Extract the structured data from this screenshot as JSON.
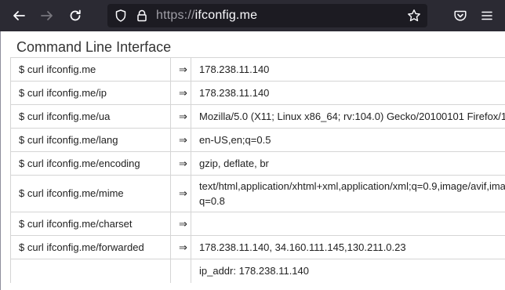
{
  "browser": {
    "url_protocol": "https://",
    "url_host": "ifconfig.me"
  },
  "page": {
    "heading": "Command Line Interface",
    "rows": [
      {
        "cmd": "$ curl ifconfig.me",
        "arrow": "⇒",
        "value": "178.238.11.140"
      },
      {
        "cmd": "$ curl ifconfig.me/ip",
        "arrow": "⇒",
        "value": "178.238.11.140"
      },
      {
        "cmd": "$ curl ifconfig.me/ua",
        "arrow": "⇒",
        "value": "Mozilla/5.0 (X11; Linux x86_64; rv:104.0) Gecko/20100101 Firefox/1"
      },
      {
        "cmd": "$ curl ifconfig.me/lang",
        "arrow": "⇒",
        "value": "en-US,en;q=0.5"
      },
      {
        "cmd": "$ curl ifconfig.me/encoding",
        "arrow": "⇒",
        "value": "gzip, deflate, br"
      },
      {
        "cmd": "$ curl ifconfig.me/mime",
        "arrow": "⇒",
        "value": "text/html,application/xhtml+xml,application/xml;q=0.9,image/avif,ima",
        "value2": "q=0.8"
      },
      {
        "cmd": "$ curl ifconfig.me/charset",
        "arrow": "⇒",
        "value": ""
      },
      {
        "cmd": "$ curl ifconfig.me/forwarded",
        "arrow": "⇒",
        "value": "178.238.11.140, 34.160.111.145,130.211.0.23"
      },
      {
        "cmd": "",
        "arrow": "",
        "value": "ip_addr: 178.238.11.140"
      }
    ]
  }
}
